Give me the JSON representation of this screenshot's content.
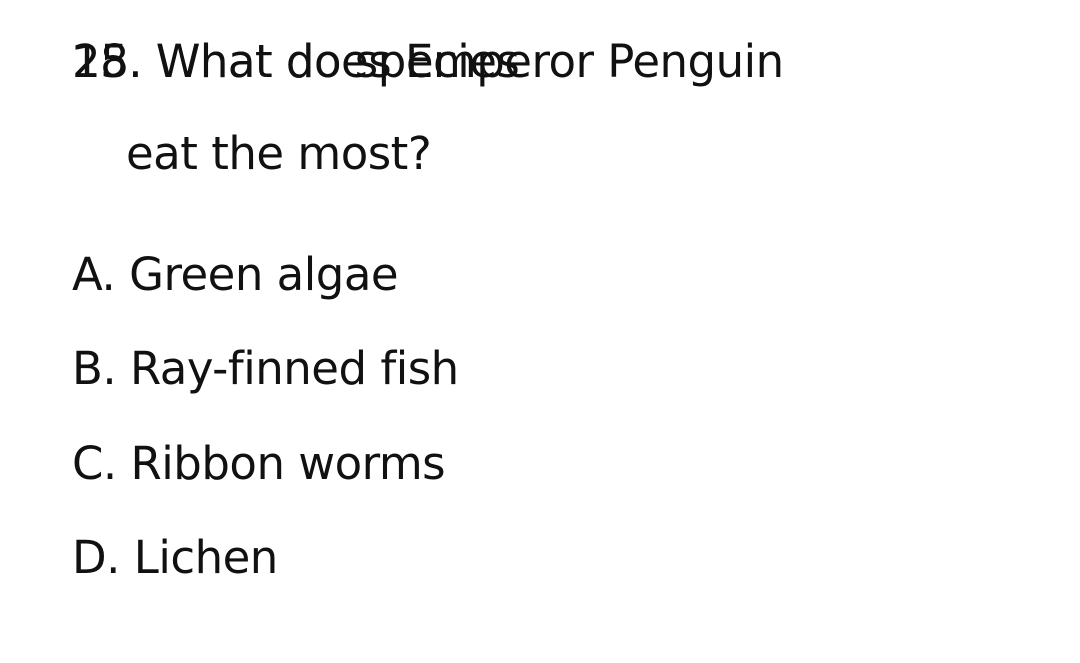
{
  "question": {
    "overlap_text_1": "28. What does Emperor Penguin",
    "overlap_text_2": "15. What do species",
    "continuation": "eat the most?"
  },
  "options": [
    {
      "label": "A. Green algae"
    },
    {
      "label": "B. Ray-finned fish"
    },
    {
      "label": "C. Ribbon worms"
    },
    {
      "label": "D. Lichen"
    }
  ]
}
